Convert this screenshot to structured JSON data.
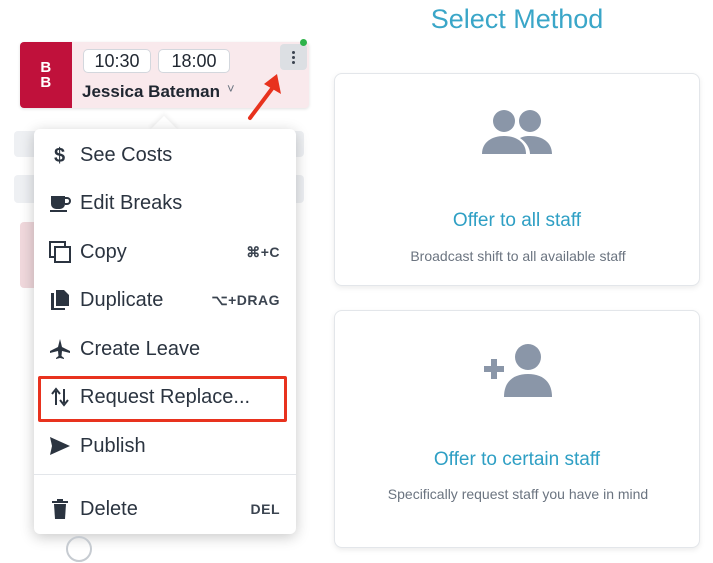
{
  "shift": {
    "avatar_initials_line1": "B",
    "avatar_initials_line2": "B",
    "start_time": "10:30",
    "end_time": "18:00",
    "staff_name": "Jessica Bateman",
    "caret": "˅"
  },
  "context_menu": {
    "items": [
      {
        "label": "See Costs",
        "icon": "dollar-icon",
        "shortcut": ""
      },
      {
        "label": "Edit Breaks",
        "icon": "coffee-cup-icon",
        "shortcut": ""
      },
      {
        "label": "Copy",
        "icon": "copy-icon",
        "shortcut": "⌘+C"
      },
      {
        "label": "Duplicate",
        "icon": "duplicate-icon",
        "shortcut": "⌥+DRAG"
      },
      {
        "label": "Create Leave",
        "icon": "airplane-icon",
        "shortcut": ""
      },
      {
        "label": "Request Replace...",
        "icon": "swap-icon",
        "shortcut": ""
      },
      {
        "label": "Publish",
        "icon": "send-icon",
        "shortcut": ""
      },
      {
        "label": "Delete",
        "icon": "trash-icon",
        "shortcut": "DEL"
      }
    ]
  },
  "method_panel": {
    "title": "Select Method",
    "options": [
      {
        "title": "Offer to all staff",
        "description": "Broadcast shift to all available staff",
        "icon": "users-group-icon"
      },
      {
        "title": "Offer to certain staff",
        "description": "Specifically request staff you have in mind",
        "icon": "add-user-icon"
      }
    ]
  },
  "colors": {
    "avatar_bg": "#c0113b",
    "shift_bg": "#f9e9ec",
    "accent_blue": "#3aa6c8",
    "highlight_red": "#e8321e",
    "icon_gray": "#8a96a8",
    "status_green": "#2fb34a"
  }
}
